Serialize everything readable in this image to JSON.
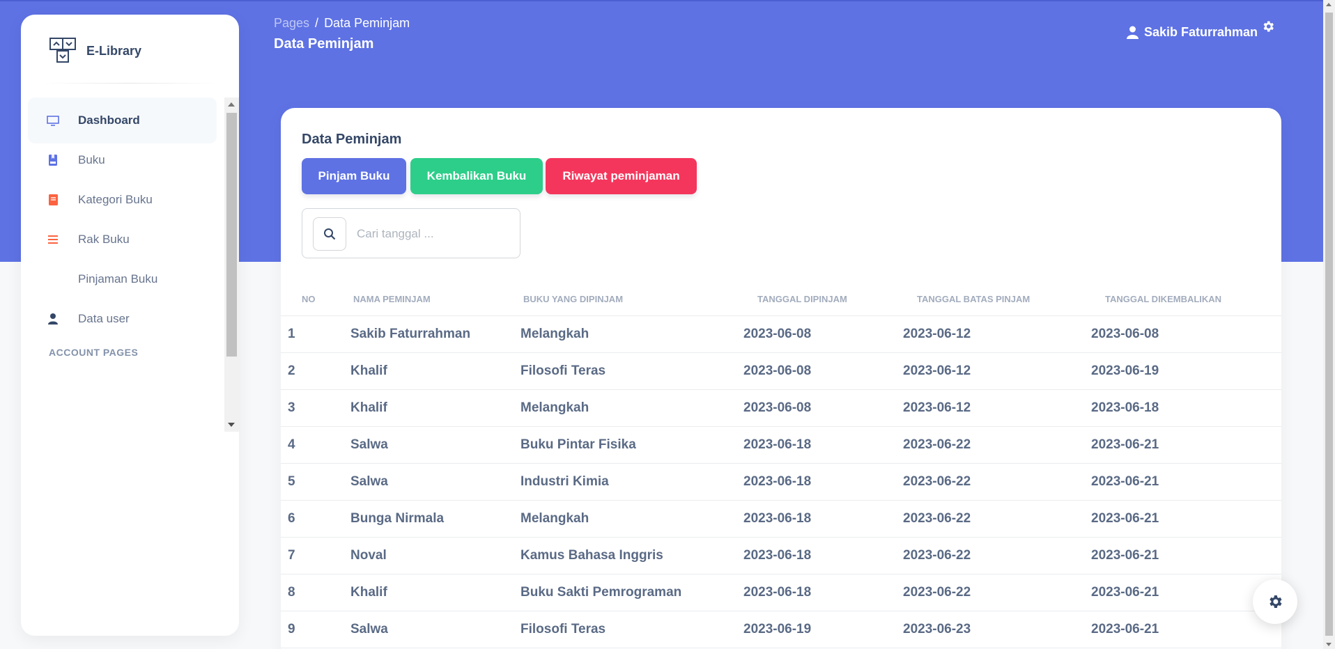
{
  "brand": {
    "name": "E-Library"
  },
  "header": {
    "breadcrumb_root": "Pages",
    "breadcrumb_sep": "/",
    "breadcrumb_current": "Data Peminjam",
    "title": "Data Peminjam",
    "user_name": "Sakib Faturrahman"
  },
  "sidebar": {
    "items": [
      {
        "label": "Dashboard",
        "icon": "monitor-icon"
      },
      {
        "label": "Buku",
        "icon": "bookmark-icon"
      },
      {
        "label": "Kategori Buku",
        "icon": "book-icon"
      },
      {
        "label": "Rak Buku",
        "icon": "list-icon"
      },
      {
        "label": "Pinjaman Buku",
        "icon": ""
      },
      {
        "label": "Data user",
        "icon": "user-icon"
      }
    ],
    "section_label": "ACCOUNT PAGES"
  },
  "main": {
    "card_title": "Data Peminjam",
    "buttons": {
      "pinjam": "Pinjam Buku",
      "kembalikan": "Kembalikan Buku",
      "riwayat": "Riwayat peminjaman"
    },
    "search": {
      "placeholder": "Cari tanggal ..."
    },
    "table": {
      "headers": [
        "NO",
        "NAMA PEMINJAM",
        "BUKU YANG DIPINJAM",
        "TANGGAL DIPINJAM",
        "TANGGAL BATAS PINJAM",
        "TANGGAL DIKEMBALIKAN"
      ],
      "rows": [
        [
          "1",
          "Sakib Faturrahman",
          "Melangkah",
          "2023-06-08",
          "2023-06-12",
          "2023-06-08"
        ],
        [
          "2",
          "Khalif",
          "Filosofi Teras",
          "2023-06-08",
          "2023-06-12",
          "2023-06-19"
        ],
        [
          "3",
          "Khalif",
          "Melangkah",
          "2023-06-08",
          "2023-06-12",
          "2023-06-18"
        ],
        [
          "4",
          "Salwa",
          "Buku Pintar Fisika",
          "2023-06-18",
          "2023-06-22",
          "2023-06-21"
        ],
        [
          "5",
          "Salwa",
          "Industri Kimia",
          "2023-06-18",
          "2023-06-22",
          "2023-06-21"
        ],
        [
          "6",
          "Bunga Nirmala",
          "Melangkah",
          "2023-06-18",
          "2023-06-22",
          "2023-06-21"
        ],
        [
          "7",
          "Noval",
          "Kamus Bahasa Inggris",
          "2023-06-18",
          "2023-06-22",
          "2023-06-21"
        ],
        [
          "8",
          "Khalif",
          "Buku Sakti Pemrograman",
          "2023-06-18",
          "2023-06-22",
          "2023-06-21"
        ],
        [
          "9",
          "Salwa",
          "Filosofi Teras",
          "2023-06-19",
          "2023-06-23",
          "2023-06-21"
        ]
      ]
    }
  },
  "colors": {
    "primary": "#5e72e4",
    "success": "#2dce89",
    "danger": "#f5365c",
    "warning": "#fb6340",
    "text": "#344767"
  }
}
